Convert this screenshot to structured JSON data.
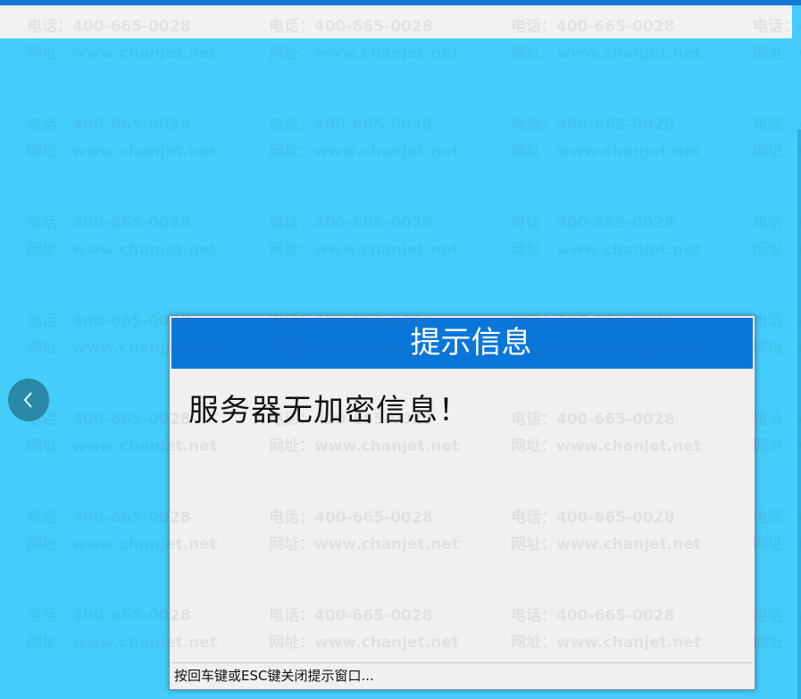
{
  "watermark": {
    "phone": "电话：400-665-0028",
    "website": "网址：www.chanjet.net"
  },
  "dialog": {
    "title": "提示信息",
    "message": "服务器无加密信息！",
    "footer_hint": "按回车键或ESC键关闭提示窗口..."
  },
  "colors": {
    "background": "#44cdfb",
    "title_bar": "#0b76d9",
    "dialog_body": "#f0f0f0",
    "nav_button": "#2a89a6"
  },
  "icons": {
    "nav_prev": "chevron-left-icon"
  }
}
